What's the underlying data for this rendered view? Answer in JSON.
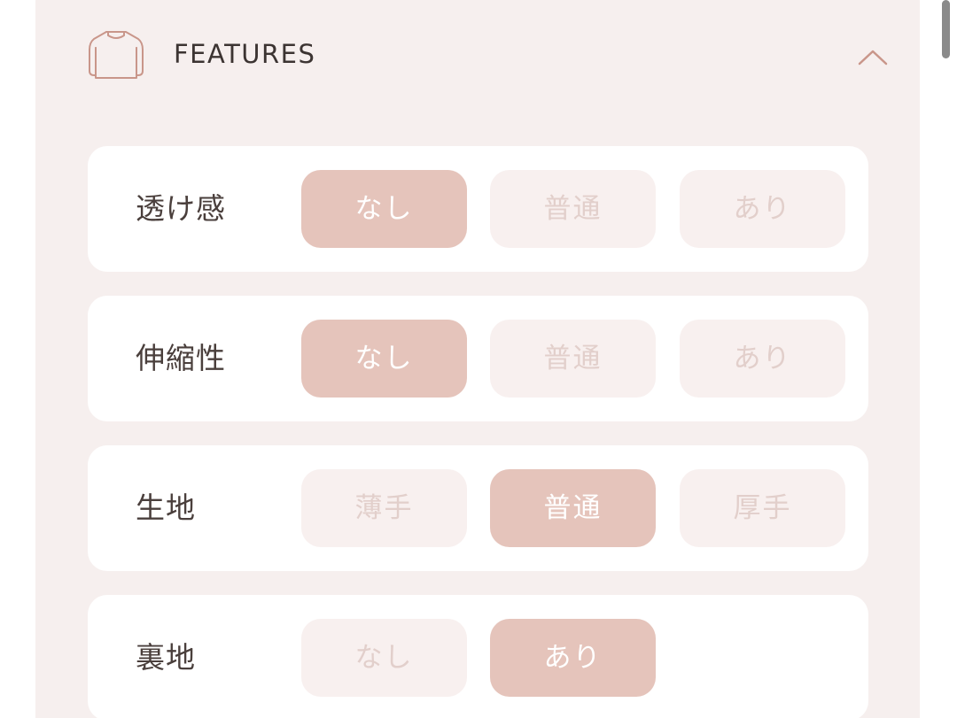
{
  "header": {
    "title": "FEATURES",
    "icon": "shirt-icon",
    "toggle_icon": "chevron-up-icon"
  },
  "colors": {
    "panel_bg": "#f6efee",
    "active": "#e5c4bb",
    "inactive_bg": "#f8f0ef",
    "inactive_text": "#e2cfcb",
    "label_text": "#4a3f3c",
    "icon_stroke": "#c9968a"
  },
  "features": [
    {
      "label": "透け感",
      "options": [
        "なし",
        "普通",
        "あり"
      ],
      "selected": "なし"
    },
    {
      "label": "伸縮性",
      "options": [
        "なし",
        "普通",
        "あり"
      ],
      "selected": "なし"
    },
    {
      "label": "生地",
      "options": [
        "薄手",
        "普通",
        "厚手"
      ],
      "selected": "普通"
    },
    {
      "label": "裏地",
      "options": [
        "なし",
        "あり"
      ],
      "selected": "あり"
    }
  ]
}
